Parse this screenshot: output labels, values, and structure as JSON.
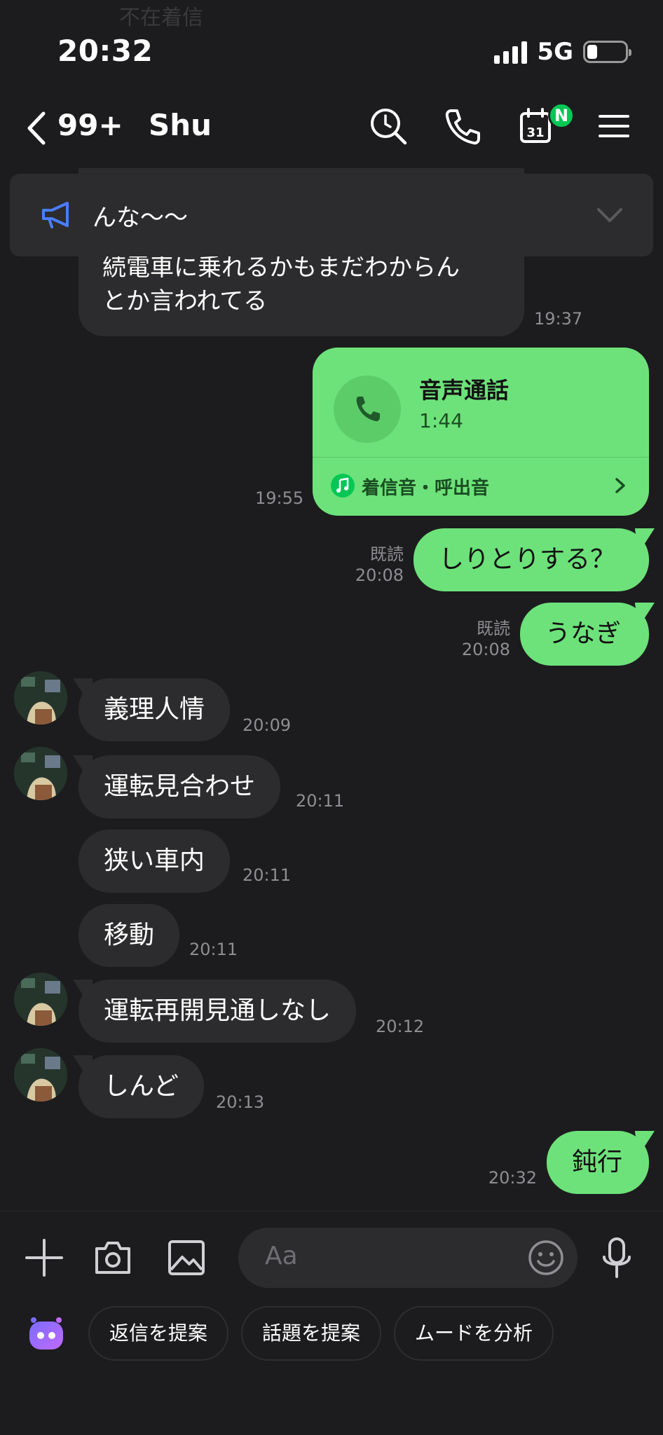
{
  "status": {
    "time": "20:32",
    "network": "5G"
  },
  "ghost_banner": "不在着信",
  "header": {
    "unread": "99+",
    "title": "Shu",
    "calendar_day": "31",
    "calendar_badge": "N"
  },
  "announcement": {
    "text": "んな〜〜"
  },
  "messages": {
    "partial_text_1": "続電車に乗れるかもまだわからん",
    "partial_text_2": "とか言われてる",
    "partial_time": "19:37",
    "call": {
      "title": "音声通話",
      "duration": "1:44",
      "ringtone": "着信音・呼出音",
      "time": "19:55"
    },
    "m1": {
      "text": "しりとりする？",
      "read": "既読",
      "time": "20:08"
    },
    "m2": {
      "text": "うなぎ",
      "read": "既読",
      "time": "20:08"
    },
    "m3": {
      "text": "義理人情",
      "time": "20:09"
    },
    "m4": {
      "text": "運転見合わせ",
      "time": "20:11"
    },
    "m5": {
      "text": "狭い車内",
      "time": "20:11"
    },
    "m6": {
      "text": "移動",
      "time": "20:11"
    },
    "m7": {
      "text": "運転再開見通しなし",
      "time": "20:12"
    },
    "m8": {
      "text": "しんど",
      "time": "20:13"
    },
    "m9": {
      "text": "鈍行",
      "time": "20:32"
    }
  },
  "composer": {
    "placeholder": "Aa"
  },
  "suggestions": [
    "返信を提案",
    "話題を提案",
    "ムードを分析"
  ],
  "colors": {
    "outgoing": "#6de27a",
    "incoming": "#2c2c2e",
    "background": "#1c1c1e",
    "accent": "#06c755"
  }
}
